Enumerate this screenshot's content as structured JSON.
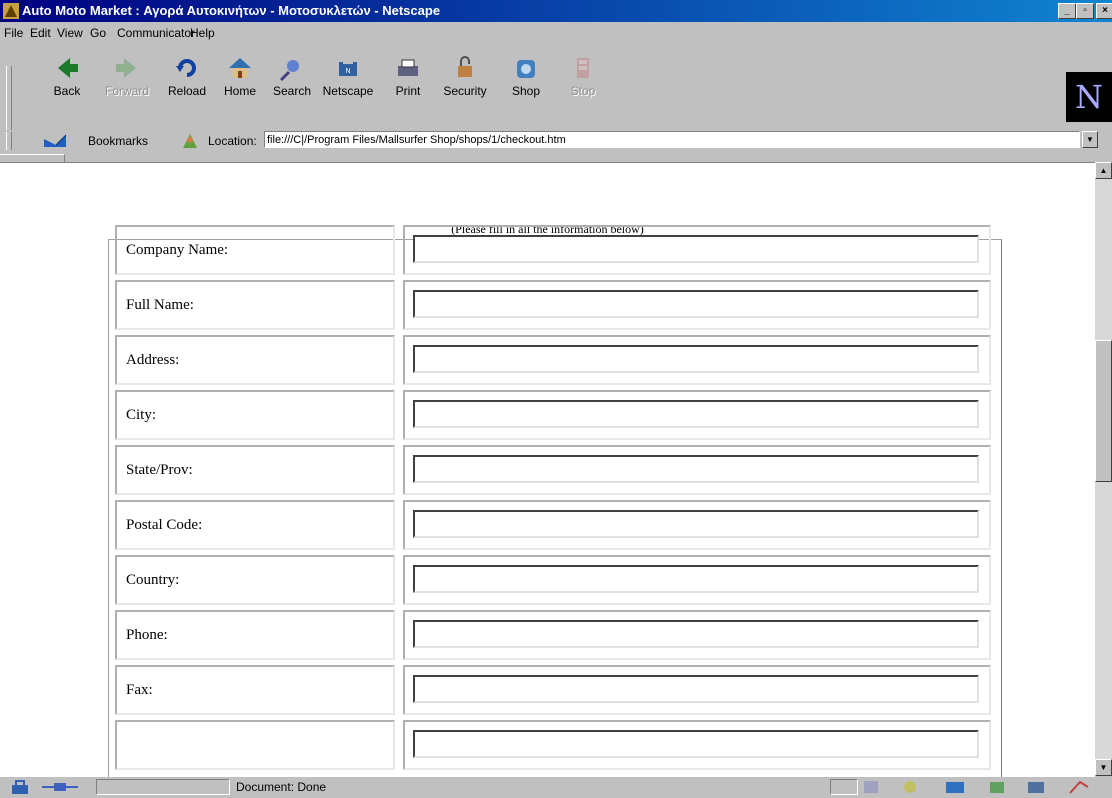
{
  "window": {
    "title": "Auto Moto Market : Αγορά Αυτοκινήτων - Μοτοσυκλετών - Netscape"
  },
  "menu": [
    "File",
    "Edit",
    "View",
    "Go",
    "Communicator",
    "Help"
  ],
  "toolbar": {
    "buttons": [
      {
        "label": "Back",
        "icon": "back-arrow-icon",
        "enabled": true
      },
      {
        "label": "Forward",
        "icon": "forward-arrow-icon",
        "enabled": false
      },
      {
        "label": "Reload",
        "icon": "reload-icon",
        "enabled": true
      },
      {
        "label": "Home",
        "icon": "home-icon",
        "enabled": true
      },
      {
        "label": "Search",
        "icon": "search-icon",
        "enabled": true
      },
      {
        "label": "Netscape",
        "icon": "netscape-icon",
        "enabled": true
      },
      {
        "label": "Print",
        "icon": "printer-icon",
        "enabled": true
      },
      {
        "label": "Security",
        "icon": "lock-icon",
        "enabled": true
      },
      {
        "label": "Shop",
        "icon": "shop-icon",
        "enabled": true
      },
      {
        "label": "Stop",
        "icon": "stop-icon",
        "enabled": false
      }
    ]
  },
  "location_bar": {
    "bookmarks_label": "Bookmarks",
    "location_label": "Location:",
    "url": "file:///C|/Program Files/Mallsurfer Shop/shops/1/checkout.htm"
  },
  "page": {
    "note": "(Please fill in all the information below)",
    "fields": [
      {
        "label": "Company Name:",
        "value": ""
      },
      {
        "label": "Full Name:",
        "value": ""
      },
      {
        "label": "Address:",
        "value": ""
      },
      {
        "label": "City:",
        "value": ""
      },
      {
        "label": "State/Prov:",
        "value": ""
      },
      {
        "label": "Postal Code:",
        "value": ""
      },
      {
        "label": "Country:",
        "value": ""
      },
      {
        "label": "Phone:",
        "value": ""
      },
      {
        "label": "Fax:",
        "value": ""
      }
    ]
  },
  "status": {
    "text": "Document: Done"
  }
}
